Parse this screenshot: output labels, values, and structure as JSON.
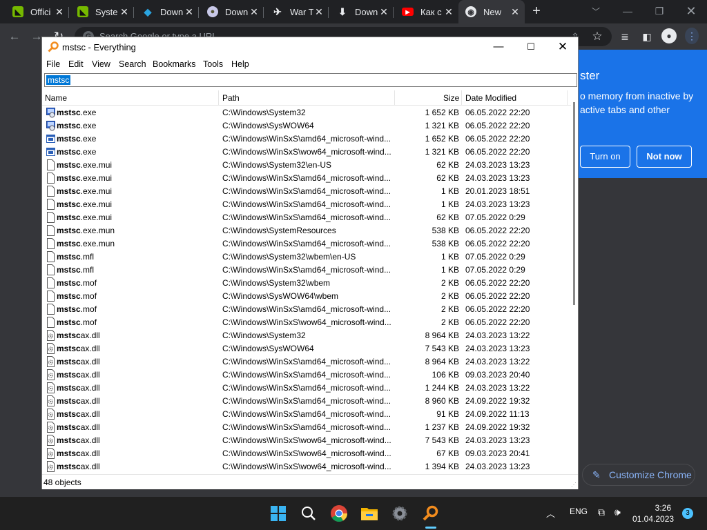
{
  "chrome": {
    "tabs": [
      {
        "label": "Offici",
        "icon": "nvidia-icon"
      },
      {
        "label": "Syste",
        "icon": "nvidia-icon"
      },
      {
        "label": "Down",
        "icon": "download-site-icon"
      },
      {
        "label": "Down",
        "icon": "globe-icon"
      },
      {
        "label": "War T",
        "icon": "game-icon"
      },
      {
        "label": "Down",
        "icon": "download-icon"
      },
      {
        "label": "Как с",
        "icon": "youtube-icon"
      },
      {
        "label": "New",
        "icon": "chrome-icon"
      }
    ],
    "omnibox_placeholder": "Search Google or type a URL",
    "memory_saver": {
      "title": "ster",
      "body": "o memory from inactive by active tabs and other",
      "turn_on": "Turn on",
      "not_now": "Not now"
    },
    "customize": "Customize Chrome",
    "colors": {
      "accent": "#1a73e8",
      "dark_bg": "#202124",
      "toolbar": "#35363a"
    }
  },
  "everything": {
    "title": "mstsc - Everything",
    "menu": [
      "File",
      "Edit",
      "View",
      "Search",
      "Bookmarks",
      "Tools",
      "Help"
    ],
    "search_value": "mstsc",
    "columns": {
      "name": "Name",
      "path": "Path",
      "size": "Size",
      "date": "Date Modified"
    },
    "rows": [
      {
        "match": "mstsc",
        "rest": ".exe",
        "path": "C:\\Windows\\System32",
        "size": "1 652 KB",
        "date": "06.05.2022 22:20",
        "icon": "app"
      },
      {
        "match": "mstsc",
        "rest": ".exe",
        "path": "C:\\Windows\\SysWOW64",
        "size": "1 321 KB",
        "date": "06.05.2022 22:20",
        "icon": "app"
      },
      {
        "match": "mstsc",
        "rest": ".exe",
        "path": "C:\\Windows\\WinSxS\\amd64_microsoft-wind...",
        "size": "1 652 KB",
        "date": "06.05.2022 22:20",
        "icon": "exe"
      },
      {
        "match": "mstsc",
        "rest": ".exe",
        "path": "C:\\Windows\\WinSxS\\wow64_microsoft-wind...",
        "size": "1 321 KB",
        "date": "06.05.2022 22:20",
        "icon": "exe"
      },
      {
        "match": "mstsc",
        "rest": ".exe.mui",
        "path": "C:\\Windows\\System32\\en-US",
        "size": "62 KB",
        "date": "24.03.2023 13:23",
        "icon": "file"
      },
      {
        "match": "mstsc",
        "rest": ".exe.mui",
        "path": "C:\\Windows\\WinSxS\\amd64_microsoft-wind...",
        "size": "62 KB",
        "date": "24.03.2023 13:23",
        "icon": "file"
      },
      {
        "match": "mstsc",
        "rest": ".exe.mui",
        "path": "C:\\Windows\\WinSxS\\amd64_microsoft-wind...",
        "size": "1 KB",
        "date": "20.01.2023 18:51",
        "icon": "file"
      },
      {
        "match": "mstsc",
        "rest": ".exe.mui",
        "path": "C:\\Windows\\WinSxS\\amd64_microsoft-wind...",
        "size": "1 KB",
        "date": "24.03.2023 13:23",
        "icon": "file"
      },
      {
        "match": "mstsc",
        "rest": ".exe.mui",
        "path": "C:\\Windows\\WinSxS\\amd64_microsoft-wind...",
        "size": "62 KB",
        "date": "07.05.2022 0:29",
        "icon": "file"
      },
      {
        "match": "mstsc",
        "rest": ".exe.mun",
        "path": "C:\\Windows\\SystemResources",
        "size": "538 KB",
        "date": "06.05.2022 22:20",
        "icon": "file"
      },
      {
        "match": "mstsc",
        "rest": ".exe.mun",
        "path": "C:\\Windows\\WinSxS\\amd64_microsoft-wind...",
        "size": "538 KB",
        "date": "06.05.2022 22:20",
        "icon": "file"
      },
      {
        "match": "mstsc",
        "rest": ".mfl",
        "path": "C:\\Windows\\System32\\wbem\\en-US",
        "size": "1 KB",
        "date": "07.05.2022 0:29",
        "icon": "file"
      },
      {
        "match": "mstsc",
        "rest": ".mfl",
        "path": "C:\\Windows\\WinSxS\\amd64_microsoft-wind...",
        "size": "1 KB",
        "date": "07.05.2022 0:29",
        "icon": "file"
      },
      {
        "match": "mstsc",
        "rest": ".mof",
        "path": "C:\\Windows\\System32\\wbem",
        "size": "2 KB",
        "date": "06.05.2022 22:20",
        "icon": "file"
      },
      {
        "match": "mstsc",
        "rest": ".mof",
        "path": "C:\\Windows\\SysWOW64\\wbem",
        "size": "2 KB",
        "date": "06.05.2022 22:20",
        "icon": "file"
      },
      {
        "match": "mstsc",
        "rest": ".mof",
        "path": "C:\\Windows\\WinSxS\\amd64_microsoft-wind...",
        "size": "2 KB",
        "date": "06.05.2022 22:20",
        "icon": "file"
      },
      {
        "match": "mstsc",
        "rest": ".mof",
        "path": "C:\\Windows\\WinSxS\\wow64_microsoft-wind...",
        "size": "2 KB",
        "date": "06.05.2022 22:20",
        "icon": "file"
      },
      {
        "match": "mstsc",
        "rest": "ax.dll",
        "path": "C:\\Windows\\System32",
        "size": "8 964 KB",
        "date": "24.03.2023 13:22",
        "icon": "dll"
      },
      {
        "match": "mstsc",
        "rest": "ax.dll",
        "path": "C:\\Windows\\SysWOW64",
        "size": "7 543 KB",
        "date": "24.03.2023 13:23",
        "icon": "dll"
      },
      {
        "match": "mstsc",
        "rest": "ax.dll",
        "path": "C:\\Windows\\WinSxS\\amd64_microsoft-wind...",
        "size": "8 964 KB",
        "date": "24.03.2023 13:22",
        "icon": "dll"
      },
      {
        "match": "mstsc",
        "rest": "ax.dll",
        "path": "C:\\Windows\\WinSxS\\amd64_microsoft-wind...",
        "size": "106 KB",
        "date": "09.03.2023 20:40",
        "icon": "dll"
      },
      {
        "match": "mstsc",
        "rest": "ax.dll",
        "path": "C:\\Windows\\WinSxS\\amd64_microsoft-wind...",
        "size": "1 244 KB",
        "date": "24.03.2023 13:22",
        "icon": "dll"
      },
      {
        "match": "mstsc",
        "rest": "ax.dll",
        "path": "C:\\Windows\\WinSxS\\amd64_microsoft-wind...",
        "size": "8 960 KB",
        "date": "24.09.2022 19:32",
        "icon": "dll"
      },
      {
        "match": "mstsc",
        "rest": "ax.dll",
        "path": "C:\\Windows\\WinSxS\\amd64_microsoft-wind...",
        "size": "91 KB",
        "date": "24.09.2022 11:13",
        "icon": "dll"
      },
      {
        "match": "mstsc",
        "rest": "ax.dll",
        "path": "C:\\Windows\\WinSxS\\amd64_microsoft-wind...",
        "size": "1 237 KB",
        "date": "24.09.2022 19:32",
        "icon": "dll"
      },
      {
        "match": "mstsc",
        "rest": "ax.dll",
        "path": "C:\\Windows\\WinSxS\\wow64_microsoft-wind...",
        "size": "7 543 KB",
        "date": "24.03.2023 13:23",
        "icon": "dll"
      },
      {
        "match": "mstsc",
        "rest": "ax.dll",
        "path": "C:\\Windows\\WinSxS\\wow64_microsoft-wind...",
        "size": "67 KB",
        "date": "09.03.2023 20:41",
        "icon": "dll"
      },
      {
        "match": "mstsc",
        "rest": "ax.dll",
        "path": "C:\\Windows\\WinSxS\\wow64_microsoft-wind...",
        "size": "1 394 KB",
        "date": "24.03.2023 13:23",
        "icon": "dll"
      }
    ],
    "status": "48 objects"
  },
  "taskbar": {
    "language": "ENG",
    "time": "3:26",
    "date": "01.04.2023",
    "notifications": "3"
  }
}
